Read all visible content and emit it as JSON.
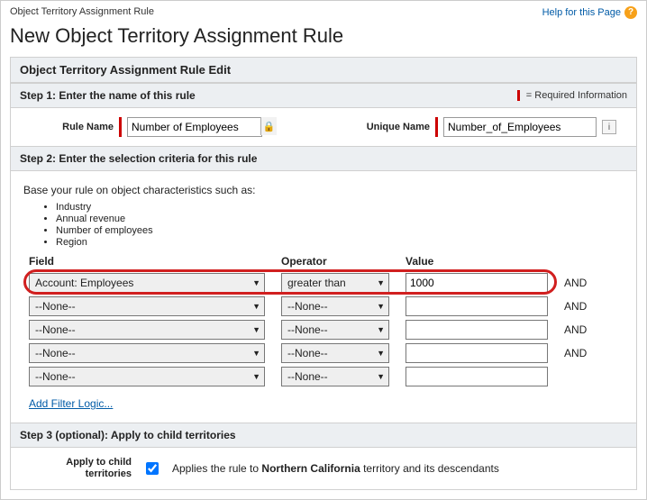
{
  "header": {
    "breadcrumb": "Object Territory Assignment Rule",
    "title": "New Object Territory Assignment Rule",
    "help_label": "Help for this Page",
    "help_glyph": "?"
  },
  "panel": {
    "title": "Object Territory Assignment Rule Edit"
  },
  "step1": {
    "heading": "Step 1: Enter the name of this rule",
    "required_info": "= Required Information",
    "rule_name_label": "Rule Name",
    "rule_name_value": "Number of Employees",
    "unique_name_label": "Unique Name",
    "unique_name_value": "Number_of_Employees",
    "info_glyph": "i"
  },
  "step2": {
    "heading": "Step 2: Enter the selection criteria for this rule",
    "intro": "Base your rule on object characteristics such as:",
    "bullets": [
      "Industry",
      "Annual revenue",
      "Number of employees",
      "Region"
    ],
    "headers": {
      "field": "Field",
      "operator": "Operator",
      "value": "Value"
    },
    "rows": [
      {
        "field": "Account: Employees",
        "operator": "greater than",
        "value": "1000",
        "join": "AND",
        "highlight": true
      },
      {
        "field": "--None--",
        "operator": "--None--",
        "value": "",
        "join": "AND"
      },
      {
        "field": "--None--",
        "operator": "--None--",
        "value": "",
        "join": "AND"
      },
      {
        "field": "--None--",
        "operator": "--None--",
        "value": "",
        "join": "AND"
      },
      {
        "field": "--None--",
        "operator": "--None--",
        "value": "",
        "join": ""
      }
    ],
    "filter_link": "Add Filter Logic..."
  },
  "step3": {
    "heading": "Step 3 (optional): Apply to child territories",
    "label": "Apply to child territories",
    "text_before": "Applies the rule to ",
    "territory": "Northern California",
    "text_after": " territory and its descendants",
    "checked": true
  }
}
